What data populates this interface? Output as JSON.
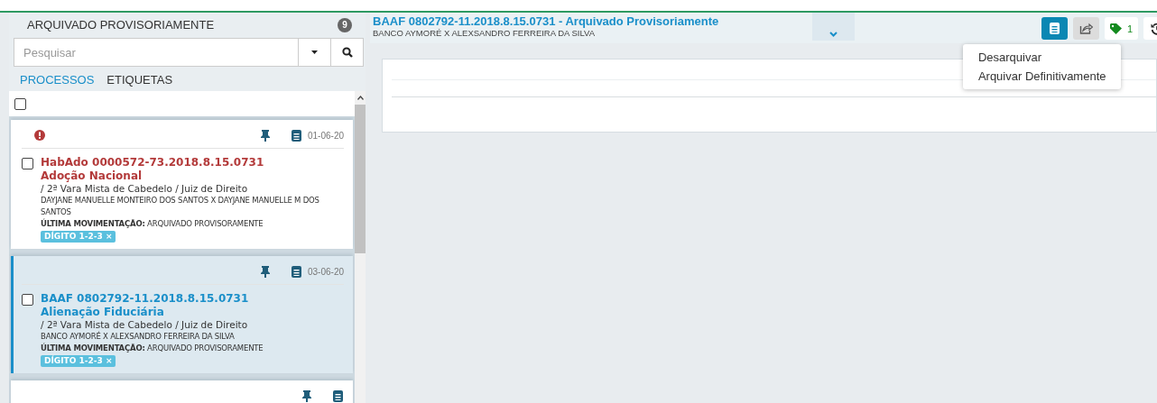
{
  "sidebar": {
    "title": "ARQUIVADO PROVISORIAMENTE",
    "count": "9",
    "search": {
      "placeholder": "Pesquisar"
    },
    "tabs": [
      {
        "label": "PROCESSOS",
        "selected": true
      },
      {
        "label": "ETIQUETAS",
        "selected": false
      }
    ],
    "select_all": {
      "checked": false
    },
    "cards": [
      {
        "kind": "full",
        "selected": false,
        "alert": true,
        "pinned": true,
        "date": "01-06-20",
        "checked": false,
        "number": "HabAdo 0000572-73.2018.8.15.0731",
        "class": "Adoção Nacional",
        "court": "/ 2ª Vara Mista de Cabedelo / Juiz de Direito",
        "parties": "DAYJANE MANUELLE MONTEIRO DOS SANTOS X DAYJANE MANUELLE M DOS SANTOS",
        "last_move": "**ÚLTIMA MOVIMENTAÇÃO:** ARQUIVADO PROVISORAMENTE",
        "tags": [
          {
            "label": "DÍGITO 1-2-3",
            "remove": "×"
          }
        ]
      },
      {
        "kind": "full",
        "selected": true,
        "alert": false,
        "pinned": true,
        "date": "03-06-20",
        "checked": false,
        "number": "BAAF 0802792-11.2018.8.15.0731",
        "class": "Alienação Fiduciária",
        "court": "/ 2ª Vara Mista de Cabedelo / Juiz de Direito",
        "parties": "BANCO AYMORÉ X ALEXSANDRO FERREIRA DA SILVA",
        "last_move": "**ÚLTIMA MOVIMENTAÇÃO:** ARQUIVADO PROVISORAMENTE",
        "tags": [
          {
            "label": "DÍGITO 1-2-3",
            "remove": "×"
          }
        ]
      },
      {
        "kind": "stub",
        "selected": false,
        "pinned": true
      }
    ]
  },
  "detail": {
    "title": "BAAF 0802792-11.2018.8.15.0731 - Arquivado Provisoriamente",
    "subtitle": "BANCO AYMORÉ X ALEXSANDRO FERREIRA DA SILVA",
    "toolbar": [
      {
        "kind": "book",
        "selected": true
      },
      {
        "kind": "share",
        "open": true
      },
      {
        "kind": "tag",
        "count": "1",
        "selected": false
      },
      {
        "kind": "history",
        "selected": false
      }
    ],
    "menu": [
      "Desarquivar",
      "Arquivar Definitivamente"
    ]
  }
}
